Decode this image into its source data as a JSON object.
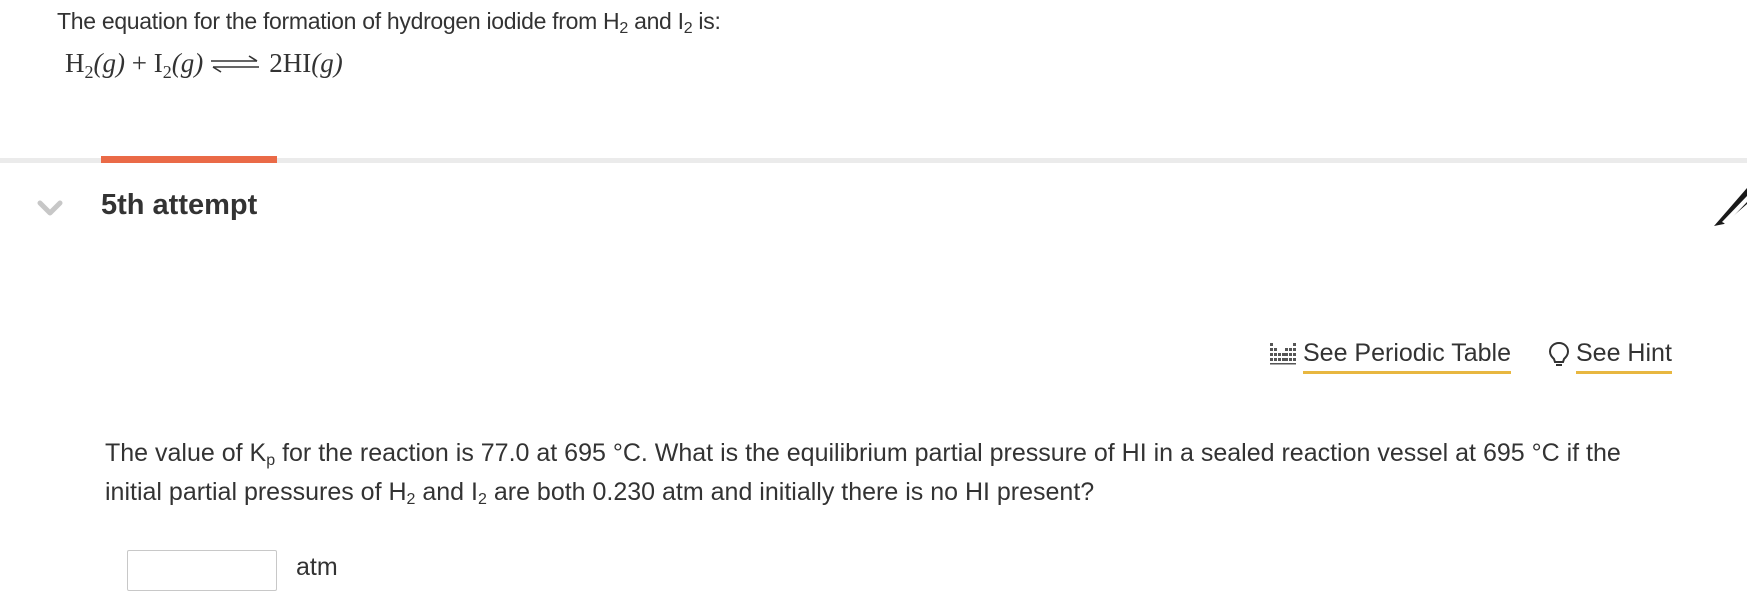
{
  "intro": {
    "text_before_h": "The equation for the formation of hydrogen iodide from H",
    "h_subscript": "2",
    "text_between": " and I",
    "i_subscript": "2",
    "text_after": " is:"
  },
  "equation": {
    "reactant1": "H",
    "reactant1_sub": "2",
    "reactant1_state": "(g)",
    "plus": " + ",
    "reactant2": "I",
    "reactant2_sub": "2",
    "reactant2_state": "(g)",
    "product": "2HI",
    "product_state": "(g)"
  },
  "attempt": {
    "title": "5th attempt"
  },
  "tools": {
    "periodic_table_label": "See Periodic Table",
    "hint_label": "See Hint"
  },
  "question": {
    "part1": "The value of K",
    "kp_sub": "p",
    "part2": " for the reaction is 77.0  at 695 °C. What is the equilibrium partial pressure of HI in a sealed reaction vessel at 695 °C if the initial partial pressures of H",
    "h_sub": "2",
    "part3": " and I",
    "i_sub": "2",
    "part4": " are both 0.230 atm and initially there is no HI present?"
  },
  "answer": {
    "value": "",
    "unit": "atm"
  },
  "colors": {
    "accent_tab": "#ea6a47",
    "link_underline": "#e8b740",
    "text": "#333333"
  }
}
